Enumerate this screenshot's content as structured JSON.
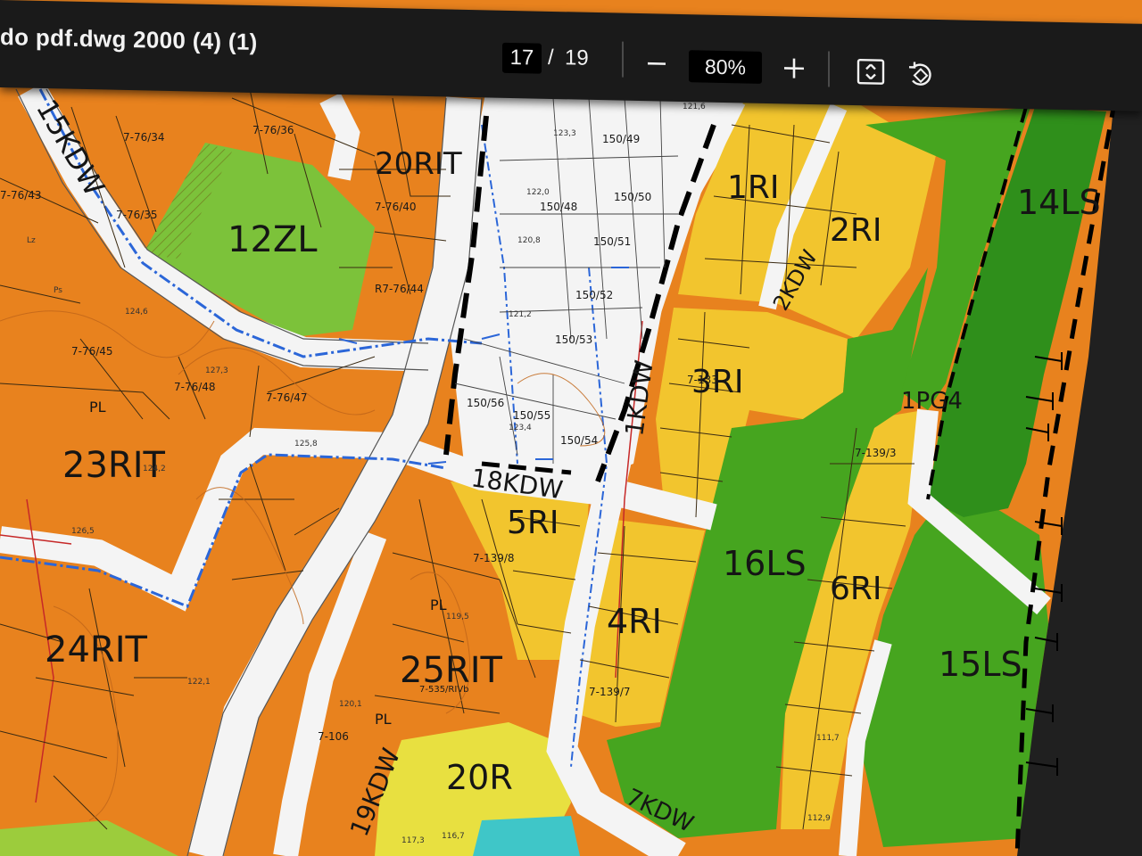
{
  "viewer": {
    "title": "do pdf.dwg 2000 (4) (1)",
    "page_current": "17",
    "page_separator": "/",
    "page_total": "19",
    "zoom": "80%",
    "icons": [
      "minus-icon",
      "plus-icon",
      "fit-page-icon",
      "rotate-icon"
    ]
  },
  "colors": {
    "toolbar_bg": "#1a1a1a",
    "zone_orange": "#e8821e",
    "zone_yellow": "#f2c52e",
    "zone_green": "#46a51f",
    "zone_dark_green": "#2f8f1b",
    "zone_light_green": "#7cc23a",
    "zone_white": "#f4f4f4"
  },
  "zones": {
    "z12ZL": "12ZL",
    "z20RIT": "20RIT",
    "z23RIT": "23RIT",
    "z24RIT": "24RIT",
    "z25RIT": "25RIT",
    "z20R": "20R",
    "z5RI": "5RI",
    "z4RI": "4RI",
    "z3RI": "3RI",
    "z2RI": "2RI",
    "z1RI": "1RI",
    "z6RI": "6RI",
    "z16LS": "16LS",
    "z15LS": "15LS",
    "z14LS": "14LS",
    "zPG": "1PG4",
    "r15KDW": "15KDW",
    "r18KDW": "18KDW",
    "r19KDW": "19KDW",
    "r1KDW": "1KDW",
    "r2KDW": "2KDW",
    "r7KDW": "7KDW"
  },
  "parcels": {
    "p1": "150/49",
    "p2": "150/50",
    "p3": "150/48",
    "p4": "150/51",
    "p5": "150/52",
    "p6": "150/53",
    "p7": "150/56",
    "p8": "150/55",
    "p9": "150/54",
    "p10": "7-76/34",
    "p11": "7-76/36",
    "p12": "7-76/40",
    "p13": "7-76/35",
    "p14": "7-76/45",
    "p15": "7-76/48",
    "p16": "7-76/47",
    "p17": "7-76/43",
    "p18": "R7-76/44",
    "p19": "7-139/8",
    "p20": "7-139/3",
    "p21": "7-535/RIVb",
    "p22": "7-106",
    "p23": "7-139/7",
    "p24": "7-133"
  },
  "heights": {
    "h1": "123,3",
    "h2": "122,0",
    "h3": "120,8",
    "h4": "121,2",
    "h5": "123,4",
    "h6": "125,8",
    "h7": "124,6",
    "h8": "127,3",
    "h9": "119,5",
    "h10": "120,1",
    "h11": "122,1",
    "h12": "117,3",
    "h13": "116,7",
    "h14": "111,7",
    "h15": "112,9",
    "h16": "121,6",
    "h17": "126,5",
    "h18": "124,2",
    "h19": "PL",
    "h20": "Ps",
    "h21": "Lz"
  }
}
